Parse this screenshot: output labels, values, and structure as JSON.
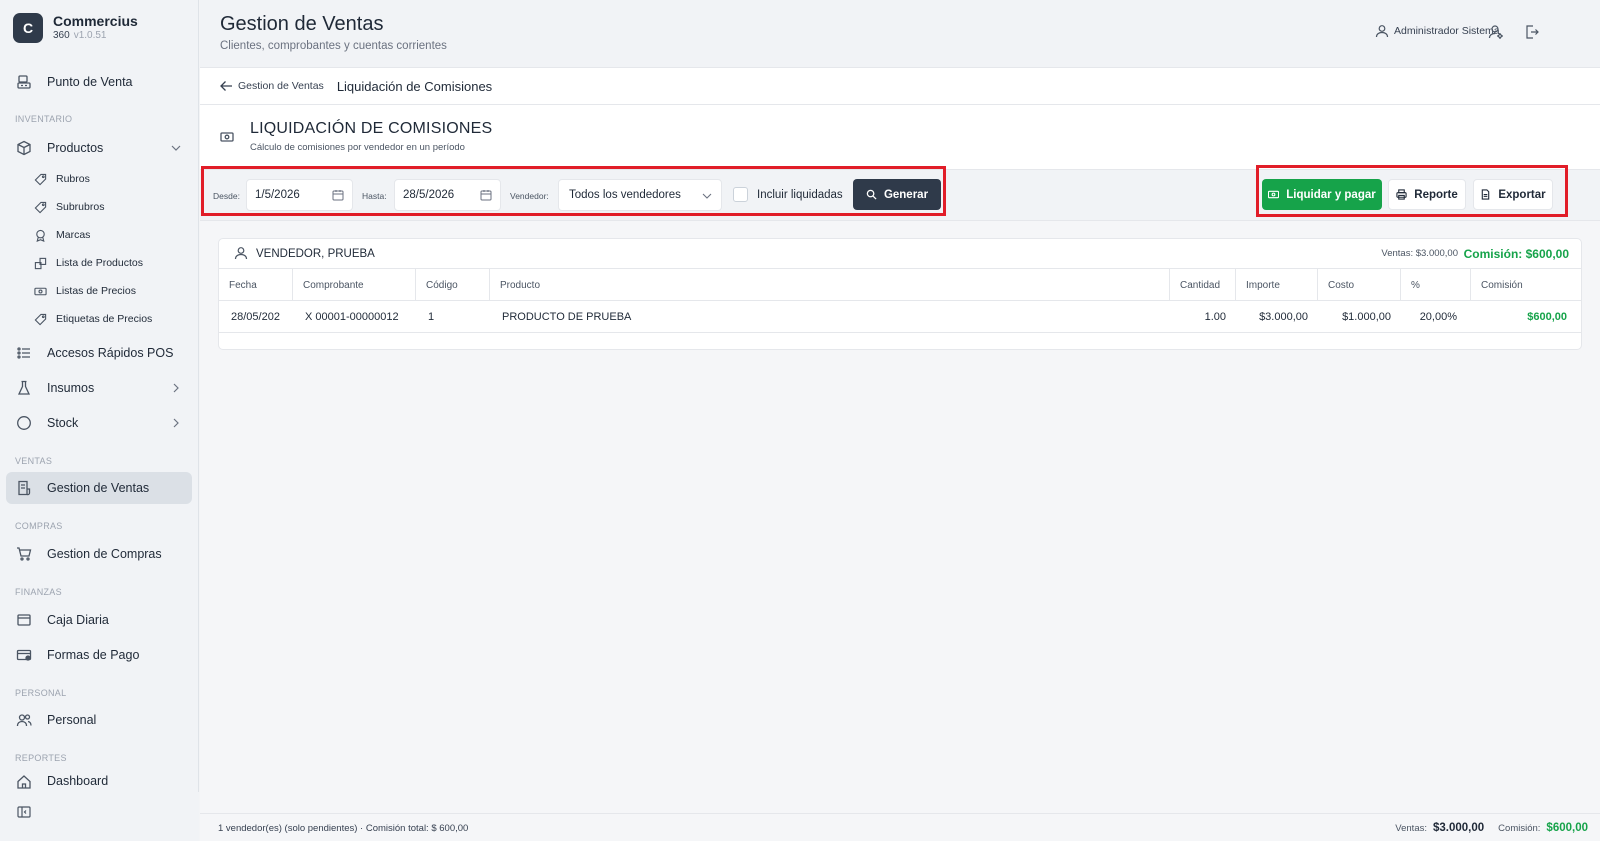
{
  "brand": {
    "logo": "C",
    "name": "Commercius",
    "sub": "360",
    "version": "v1.0.51"
  },
  "sidebar": {
    "sections": {
      "inventario": "INVENTARIO",
      "ventas": "VENTAS",
      "compras": "COMPRAS",
      "finanzas": "FINANZAS",
      "personal": "PERSONAL",
      "reportes": "REPORTES"
    },
    "items": {
      "punto_venta": "Punto de Venta",
      "productos": "Productos",
      "rubros": "Rubros",
      "subrubros": "Subrubros",
      "marcas": "Marcas",
      "lista_productos": "Lista de Productos",
      "listas_precios": "Listas de Precios",
      "etiquetas_precios": "Etiquetas de Precios",
      "accesos_rapidos": "Accesos Rápidos POS",
      "insumos": "Insumos",
      "stock": "Stock",
      "gestion_ventas": "Gestion de Ventas",
      "gestion_compras": "Gestion de Compras",
      "caja_diaria": "Caja Diaria",
      "formas_pago": "Formas de Pago",
      "personal": "Personal",
      "dashboard": "Dashboard"
    }
  },
  "header": {
    "title": "Gestion de Ventas",
    "subtitle": "Clientes, comprobantes y cuentas corrientes",
    "user": "Administrador Sistema"
  },
  "breadcrumb": {
    "parent": "Gestion de Ventas",
    "current": "Liquidación de Comisiones"
  },
  "page": {
    "title": "LIQUIDACIÓN DE COMISIONES",
    "description": "Cálculo de comisiones por vendedor en un período"
  },
  "filters": {
    "desde_label": "Desde:",
    "desde_value": "1/5/2026",
    "hasta_label": "Hasta:",
    "hasta_value": "28/5/2026",
    "vendedor_label": "Vendedor:",
    "vendedor_value": "Todos los vendedores",
    "incluir_label": "Incluir liquidadas",
    "incluir_checked": false,
    "generar": "Generar"
  },
  "actions": {
    "liquidar": "Liquidar y pagar",
    "reporte": "Reporte",
    "exportar": "Exportar"
  },
  "vendor_card": {
    "name": "VENDEDOR, PRUEBA",
    "ventas": "Ventas: $3.000,00",
    "comision": "Comisión: $600,00",
    "columns": [
      "Fecha",
      "Comprobante",
      "Código",
      "Producto",
      "Cantidad",
      "Importe",
      "Costo",
      "%",
      "Comisión"
    ],
    "rows": [
      [
        "28/05/202",
        "X 00001-00000012",
        "1",
        "PRODUCTO DE PRUEBA",
        "1.00",
        "$3.000,00",
        "$1.000,00",
        "20,00%",
        "$600,00"
      ]
    ]
  },
  "footer": {
    "summary": "1 vendedor(es) (solo pendientes) · Comisión total: $ 600,00",
    "ventas_label": "Ventas:",
    "ventas_value": "$3.000,00",
    "comision_label": "Comisión:",
    "comision_value": "$600,00"
  },
  "colors": {
    "accent_green": "#16a34a",
    "dark_button": "#2f3a4a",
    "highlight": "#e11d28"
  }
}
